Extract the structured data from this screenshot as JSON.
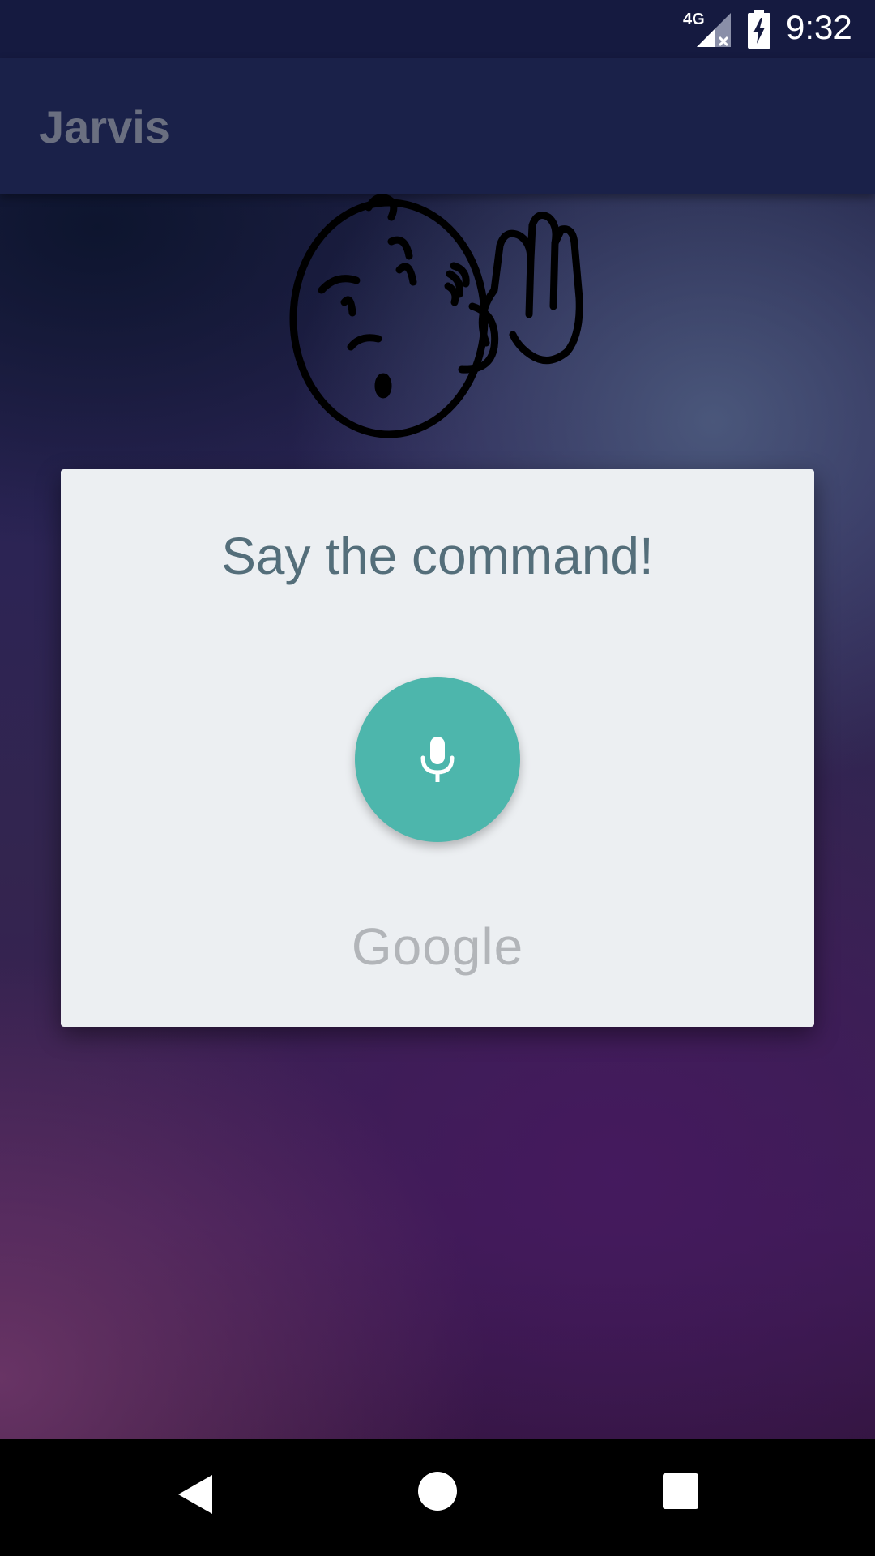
{
  "status_bar": {
    "network": "4G",
    "time": "9:32"
  },
  "app_bar": {
    "title": "Jarvis"
  },
  "dialog": {
    "prompt": "Say the command!",
    "brand": "Google"
  },
  "colors": {
    "mic_button": "#4db6ac",
    "dialog_background": "#eceff2",
    "prompt_text": "#546e7a",
    "app_bar": "#1a2149"
  },
  "icons": {
    "mic": "microphone-icon",
    "back": "back-triangle-icon",
    "home": "home-circle-icon",
    "recents": "recents-square-icon"
  }
}
